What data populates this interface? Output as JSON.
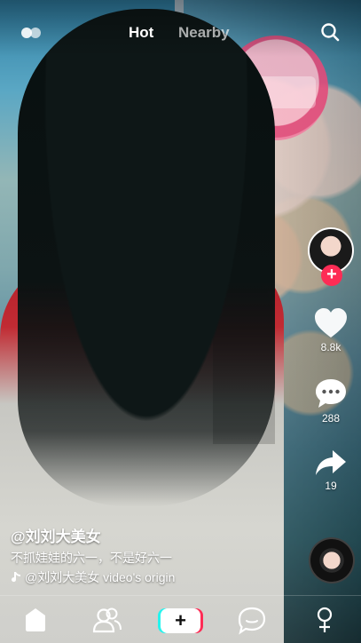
{
  "top_bar": {
    "tabs": [
      "Hot",
      "Nearby"
    ],
    "active_tab": "Hot",
    "icons": [
      "live-icon",
      "search-icon"
    ]
  },
  "sidebar": {
    "avatar": "avatar",
    "follow_icon": "plus-icon",
    "like_count": "8.8k",
    "comment_count": "288",
    "share_count": "19",
    "record": "music-disc"
  },
  "video_info": {
    "username": "@刘刘大美女",
    "caption": "不抓娃娃的六一，不是好六一",
    "music_text": "@刘刘大美女 video's origin"
  },
  "bottom_nav": {
    "items": [
      "home-icon",
      "friends-icon",
      "add-icon",
      "inbox-icon",
      "profile-icon"
    ],
    "add_symbol": "+"
  },
  "colors": {
    "accent": "#fe2c55",
    "cyan": "#25f4ee"
  }
}
